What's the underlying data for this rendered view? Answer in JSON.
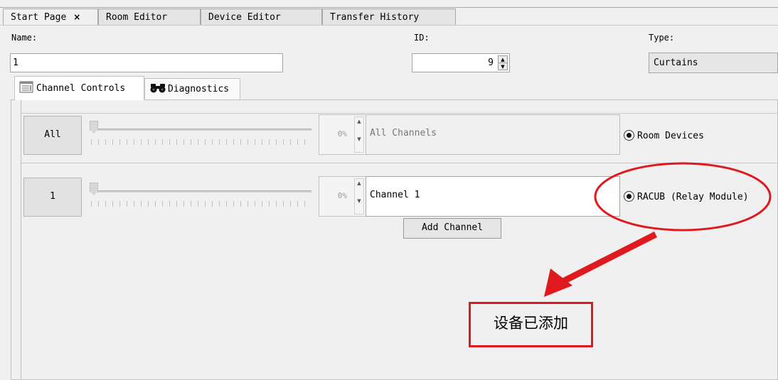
{
  "doc_tabs": [
    {
      "label": "Start Page",
      "close": "×"
    },
    {
      "label": "Room Editor"
    },
    {
      "label": "Device Editor"
    },
    {
      "label": "Transfer History"
    }
  ],
  "form": {
    "name_label": "Name:",
    "name_value": "1",
    "id_label": "ID:",
    "id_value": "9",
    "type_label": "Type:",
    "type_value": "Curtains"
  },
  "inner_tabs": [
    {
      "label": "Channel Controls",
      "icon": "channel-controls-icon"
    },
    {
      "label": "Diagnostics",
      "icon": "binoculars-icon"
    }
  ],
  "channels": [
    {
      "button": "All",
      "level": "0%",
      "level_fraction": 0,
      "name": "All Channels",
      "device": "Room Devices"
    },
    {
      "button": "1",
      "level": "0%",
      "level_fraction": 0,
      "name": "Channel 1",
      "device": "RACUB (Relay Module)"
    }
  ],
  "add_channel_label": "Add Channel",
  "annotation": {
    "text": "设备已添加",
    "color": "#e0191f"
  }
}
